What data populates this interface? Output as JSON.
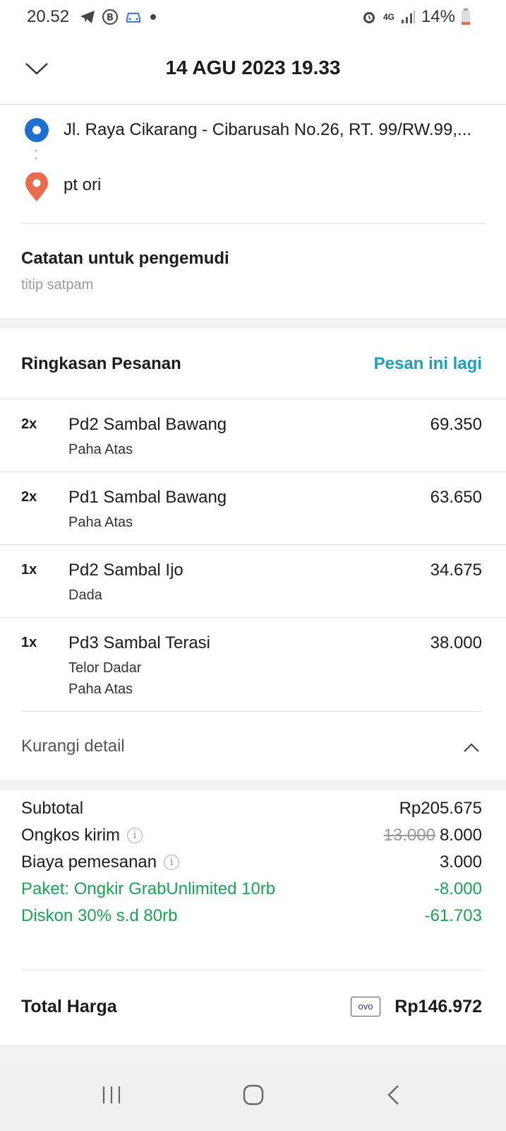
{
  "status_bar": {
    "time": "20.52",
    "network": "4G",
    "battery": "14%"
  },
  "header": {
    "title": "14 AGU 2023 19.33"
  },
  "route": {
    "pickup": "Jl. Raya Cikarang - Cibarusah No.26, RT. 99/RW.99,...",
    "dropoff": "pt ori",
    "note_title": "Catatan untuk pengemudi",
    "note_text": "titip satpam"
  },
  "summary": {
    "title": "Ringkasan Pesanan",
    "reorder_label": "Pesan ini lagi",
    "items": [
      {
        "qty": "2x",
        "name": "Pd2 Sambal Bawang",
        "price": "69.350",
        "options": [
          "Paha Atas"
        ]
      },
      {
        "qty": "2x",
        "name": "Pd1 Sambal Bawang",
        "price": "63.650",
        "options": [
          "Paha Atas"
        ]
      },
      {
        "qty": "1x",
        "name": "Pd2 Sambal Ijo",
        "price": "34.675",
        "options": [
          "Dada"
        ]
      },
      {
        "qty": "1x",
        "name": "Pd3 Sambal Terasi",
        "price": "38.000",
        "options": [
          "Telor Dadar",
          "Paha Atas"
        ]
      }
    ],
    "less_detail_label": "Kurangi detail"
  },
  "costs": {
    "subtotal_label": "Subtotal",
    "subtotal_value": "Rp205.675",
    "delivery_label": "Ongkos kirim",
    "delivery_original": "13.000",
    "delivery_value": "8.000",
    "order_fee_label": "Biaya pemesanan",
    "order_fee_value": "3.000",
    "package_label": "Paket: Ongkir GrabUnlimited 10rb",
    "package_value": "-8.000",
    "discount_label": "Diskon 30% s.d 80rb",
    "discount_value": "-61.703",
    "total_label": "Total Harga",
    "payment_method": "ovo",
    "total_value": "Rp146.972"
  },
  "colors": {
    "accent": "#1a9fc2",
    "discount_green": "#17a551",
    "pickup_blue": "#1f6fd1",
    "dropoff_red": "#e86a4f"
  }
}
